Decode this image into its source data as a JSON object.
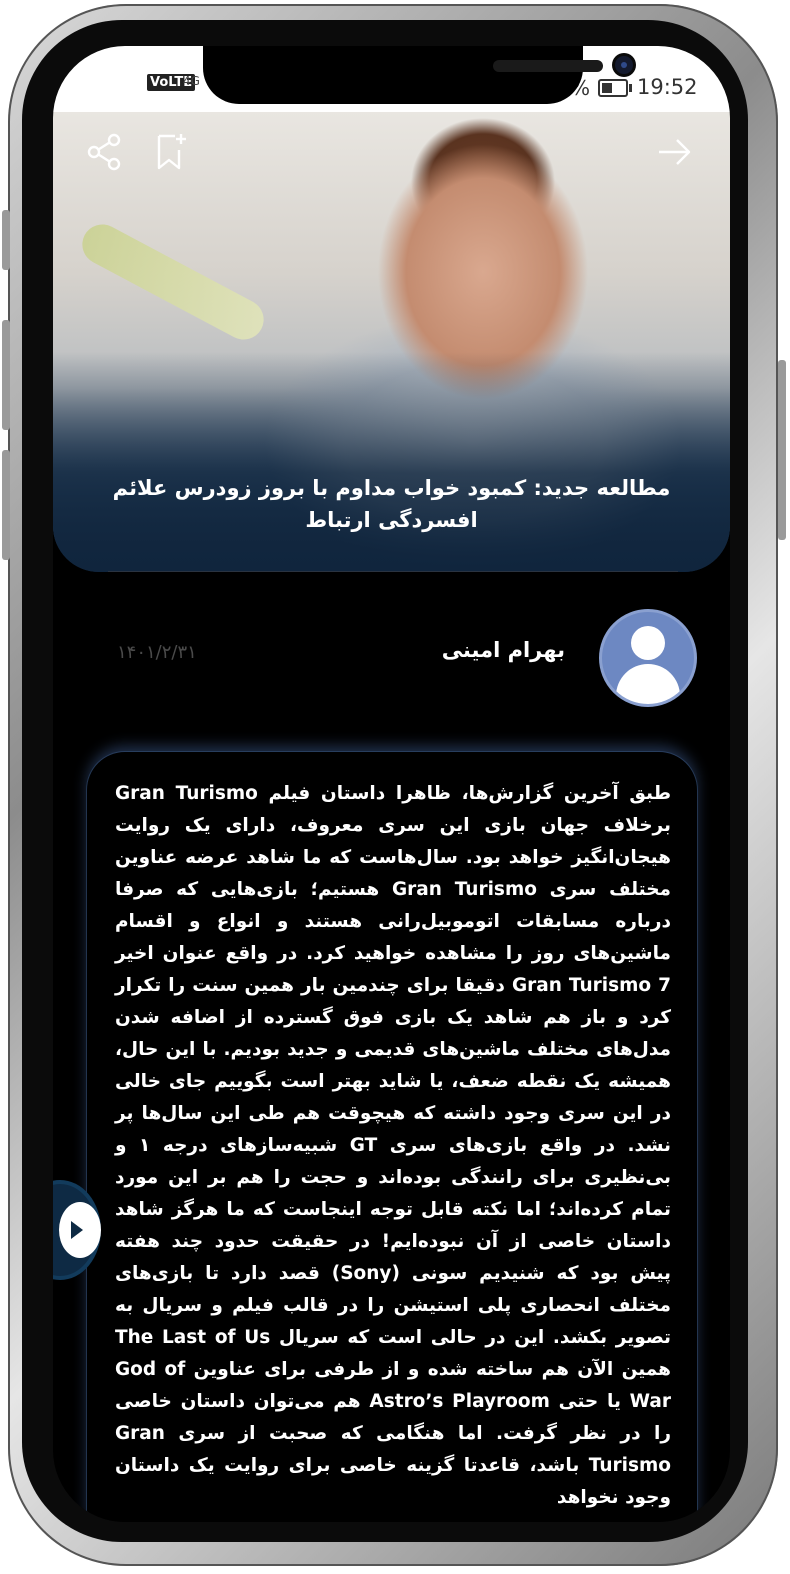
{
  "status_bar": {
    "network_label": "VoLTE",
    "network_extra": "4G",
    "battery_percent": "%",
    "time": "19:52"
  },
  "toolbar": {
    "share_icon": "share-icon",
    "bookmark_icon": "bookmark-add-icon",
    "back_icon": "arrow-right-icon"
  },
  "article": {
    "title": "مطالعه جدید: کمبود خواب مداوم با بروز زودرس علائم افسردگی ارتباط",
    "author": "بهرام امینی",
    "date": "۱۴۰۱/۲/۳۱",
    "body": "طبق آخرین گزارش‌ها، ظاهرا داستان فیلم Gran Turismo برخلاف جهان بازی این سری معروف، دارای یک روایت هیجان‌انگیز خواهد بود. سال‌هاست که ما شاهد عرضه عناوین مختلف سری Gran Turismo هستیم؛ بازی‌هایی که صرفا درباره مسابقات اتوموبیل‌رانی هستند و انواع و اقسام ماشین‌های روز را مشاهده خواهید کرد. در واقع عنوان اخیر Gran Turismo 7 دقیقا برای چندمین بار همین سنت را تکرار کرد و باز هم شاهد یک بازی فوق گسترده از اضافه شدن مدل‌های مختلف ماشین‌های قدیمی و جدید بودیم. با این حال، همیشه یک نقطه ضعف، یا شاید بهتر است بگوییم جای خالی در این سری وجود داشته که هیچوقت هم طی این سال‌ها پر نشد. در واقع بازی‌های سری GT شبیه‌سازهای درجه ۱ و بی‌نظیری برای رانندگی بوده‌اند و حجت را هم بر این مورد تمام کرده‌اند؛ اما نکته قابل توجه اینجاست که ما هرگز شاهد داستان خاصی از آن نبوده‌ایم! در حقیقت حدود چند هفته پیش بود که شنیدیم سونی (Sony) قصد دارد تا بازی‌های مختلف انحصاری پلی استیشن را در قالب فیلم و سریال به تصویر بکشد. این در حالی است که سریال The Last of Us همین الآن هم ساخته شده و از طرفی برای عناوین God of War یا حتی Astro’s Playroom هم می‌توان داستان خاصی را در نظر گرفت. اما هنگامی که صحبت از سری Gran Turismo باشد، قاعدتا گزینه خاصی برای روایت یک داستان وجود نخواهد"
  },
  "colors": {
    "background": "#000000",
    "hero_overlay": "#10253d",
    "avatar_bg": "#6d88c2",
    "date_text": "#4a4a4a",
    "text": "#ffffff"
  }
}
